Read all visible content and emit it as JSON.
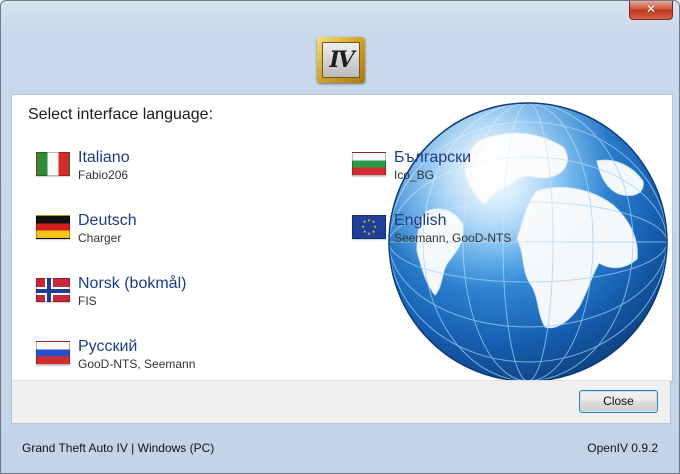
{
  "window": {
    "close_glyph": "✕"
  },
  "logo": {
    "text": "IV",
    "icon": "openiv-logo-icon"
  },
  "heading": "Select interface language:",
  "languages": [
    {
      "name": "Italiano",
      "credit": "Fabio206",
      "flag": "italy-flag-icon"
    },
    {
      "name": "Deutsch",
      "credit": "Charger",
      "flag": "germany-flag-icon"
    },
    {
      "name": "Norsk (bokmål)",
      "credit": "FIS",
      "flag": "norway-flag-icon"
    },
    {
      "name": "Русский",
      "credit": "GooD-NTS, Seemann",
      "flag": "russia-flag-icon"
    },
    {
      "name": "Български",
      "credit": "Ico_BG",
      "flag": "bulgaria-flag-icon"
    },
    {
      "name": "English",
      "credit": "Seemann, GooD-NTS",
      "flag": "eu-flag-icon"
    }
  ],
  "buttons": {
    "close": "Close"
  },
  "status": {
    "left": "Grand Theft Auto IV | Windows (PC)",
    "right": "OpenIV 0.9.2"
  },
  "colors": {
    "link": "#1f3a86",
    "button_border": "#3c7fb1",
    "ocean": "#1e74c8"
  }
}
